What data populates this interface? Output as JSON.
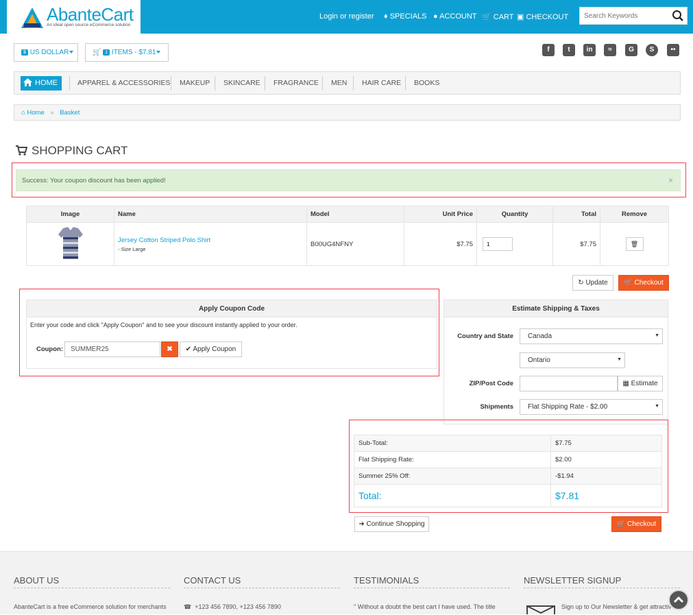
{
  "header": {
    "logo_title": "AbanteCart",
    "logo_subtitle": "An ideal open source eCommerce solution",
    "nav": {
      "login": "Login or register",
      "specials": "SPECIALS",
      "account": "ACCOUNT",
      "cart": "CART",
      "checkout": "CHECKOUT"
    },
    "search_placeholder": "Search Keywords"
  },
  "toolbar": {
    "currency_badge": "$",
    "currency": "US DOLLAR",
    "cart_count": "1",
    "cart_summary": "ITEMS - $7.81"
  },
  "social_icons": [
    "facebook-icon",
    "twitter-icon",
    "linkedin-icon",
    "rss-icon",
    "google-icon",
    "skype-icon",
    "flickr-icon"
  ],
  "categories": {
    "home": "HOME",
    "items": [
      "APPAREL & ACCESSORIES",
      "MAKEUP",
      "SKINCARE",
      "FRAGRANCE",
      "MEN",
      "HAIR CARE",
      "BOOKS"
    ]
  },
  "breadcrumb": {
    "home": "Home",
    "current": "Basket"
  },
  "page_title": "SHOPPING CART",
  "alert": {
    "message": "Success: Your coupon discount has been applied!",
    "close": "×"
  },
  "cart_table": {
    "headers": {
      "image": "Image",
      "name": "Name",
      "model": "Model",
      "unit_price": "Unit Price",
      "quantity": "Quantity",
      "total": "Total",
      "remove": "Remove"
    },
    "rows": [
      {
        "name": "Jersey Cotton Striped Polo Shirt",
        "option": "- Size Large",
        "model": "B00UG4NFNY",
        "unit_price": "$7.75",
        "quantity": "1",
        "total": "$7.75"
      }
    ]
  },
  "actions": {
    "update": "Update",
    "checkout": "Checkout",
    "continue": "Continue Shopping"
  },
  "coupon": {
    "title": "Apply Coupon Code",
    "description": "Enter your code and click \"Apply Coupon\" and to see your discount instantly applied to your order.",
    "label": "Coupon:",
    "value": "SUMMER25",
    "apply": "Apply Coupon"
  },
  "shipping": {
    "title": "Estimate Shipping & Taxes",
    "country_label": "Country and State",
    "country": "Canada",
    "state": "Ontario",
    "zip_label": "ZIP/Post Code",
    "zip_value": "",
    "estimate": "Estimate",
    "shipments_label": "Shipments",
    "shipment": "Flat Shipping Rate - $2.00"
  },
  "totals": [
    {
      "label": "Sub-Total:",
      "value": "$7.75"
    },
    {
      "label": "Flat Shipping Rate:",
      "value": "$2.00"
    },
    {
      "label": "Summer 25% Off:",
      "value": "-$1.94"
    }
  ],
  "grand_total": {
    "label": "Total:",
    "value": "$7.81"
  },
  "footer": {
    "about": {
      "title": "ABOUT US",
      "text": "AbanteCart is a free eCommerce solution for merchants"
    },
    "contact": {
      "title": "CONTACT US",
      "phone": "+123 456 7890, +123 456 7890"
    },
    "testimonials": {
      "title": "TESTIMONIALS",
      "text": "\" Without a doubt the best cart I have used. The title"
    },
    "newsletter": {
      "title": "NEWSLETTER SIGNUP",
      "text": "Sign up to Our Newsletter & get attractive"
    }
  },
  "colors": {
    "brand": "#0fa0d3",
    "accent": "#f15a24",
    "highlight": "#e8454d"
  }
}
